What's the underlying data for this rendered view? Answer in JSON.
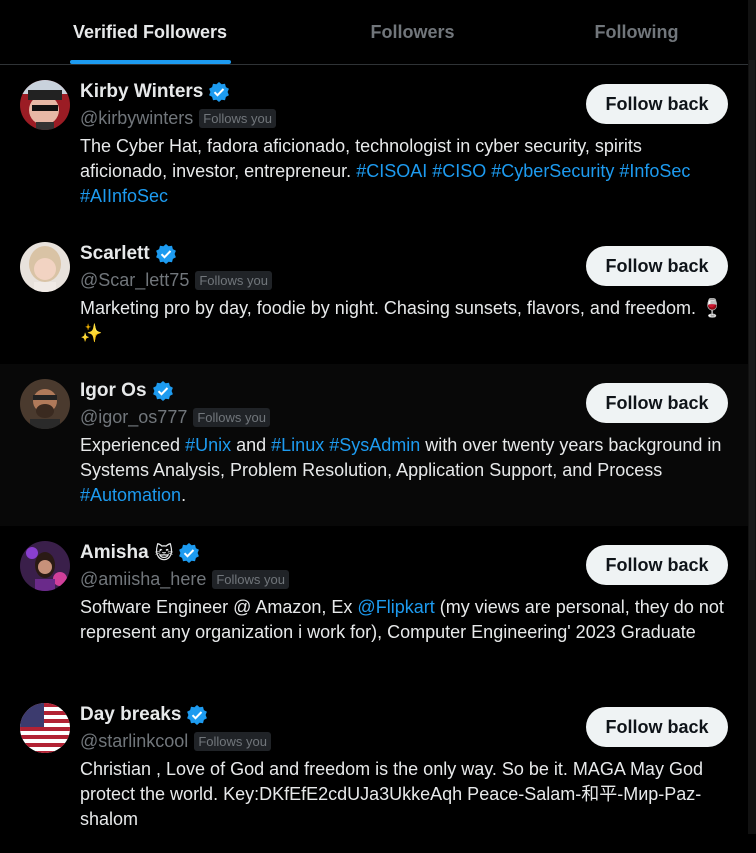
{
  "tabs": [
    {
      "label": "Verified Followers",
      "active": true
    },
    {
      "label": "Followers",
      "active": false
    },
    {
      "label": "Following",
      "active": false
    }
  ],
  "accent": "#1d9bf0",
  "follows_you_label": "Follows you",
  "follow_back_label": "Follow back",
  "users": [
    {
      "name": "Kirby Winters",
      "handle": "@kirbywinters",
      "bio": [
        {
          "t": "The Cyber Hat, fadora aficionado, technologist in cyber security, spirits aficionado, investor, entrepreneur. "
        },
        {
          "t": "#CISOAI",
          "link": true
        },
        {
          "t": " "
        },
        {
          "t": "#CISO",
          "link": true
        },
        {
          "t": " "
        },
        {
          "t": "#CyberSecurity",
          "link": true
        },
        {
          "t": " "
        },
        {
          "t": "#InfoSec",
          "link": true
        },
        {
          "t": " "
        },
        {
          "t": "#AIInfoSec",
          "link": true
        }
      ]
    },
    {
      "name": "Scarlett",
      "handle": "@Scar_lett75",
      "bio": [
        {
          "t": "Marketing pro by day, foodie by night. Chasing sunsets, flavors, and freedom. 🍷✨"
        }
      ]
    },
    {
      "name": "Igor Os",
      "handle": "@igor_os777",
      "bio": [
        {
          "t": "Experienced "
        },
        {
          "t": "#Unix",
          "link": true
        },
        {
          "t": " and "
        },
        {
          "t": "#Linux",
          "link": true
        },
        {
          "t": " "
        },
        {
          "t": "#SysAdmin",
          "link": true
        },
        {
          "t": " with over twenty years background in Systems Analysis, Problem Resolution, Application Support, and Process "
        },
        {
          "t": "#Automation",
          "link": true
        },
        {
          "t": "."
        }
      ]
    },
    {
      "name": "Amisha",
      "name_emoji": "😺",
      "handle": "@amiisha_here",
      "bio": [
        {
          "t": "Software Engineer @ Amazon, Ex "
        },
        {
          "t": "@Flipkart",
          "link": true
        },
        {
          "t": " (my views are personal, they do not represent any organization i work for), Computer Engineering' 2023 Graduate"
        }
      ]
    },
    {
      "name": "Day breaks",
      "handle": "@starlinkcool",
      "bio": [
        {
          "t": "Christian , Love of God and freedom is the only way. So be it. MAGA May God protect the world. Key:DKfEfE2cdUJa3UkkeAqh Peace-Salam-和平-Мир-Paz-shalom"
        }
      ]
    }
  ]
}
